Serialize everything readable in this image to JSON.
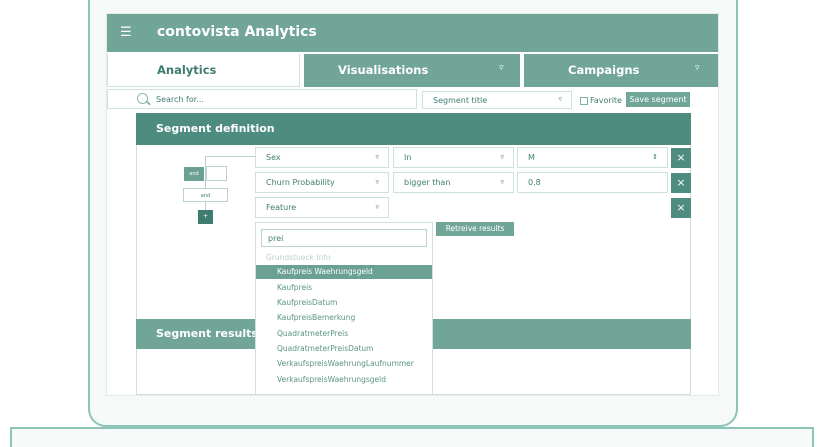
{
  "app": {
    "menu_icon": "hamburger-icon",
    "title": "contovista Analytics"
  },
  "tabs": [
    {
      "label": "Analytics",
      "active": true
    },
    {
      "label": "Visualisations",
      "caret": "▿"
    },
    {
      "label": "Campaigns",
      "caret": "▿"
    }
  ],
  "toolbar": {
    "search_placeholder": "Search for...",
    "segment_title": "Segment title",
    "favorite_label": "Favorite",
    "favorite_checked": false,
    "save_label": "Save segment"
  },
  "segment_definition": {
    "title": "Segment definition",
    "tree": {
      "node1": "and",
      "node2": "and",
      "add": "+"
    },
    "rules": [
      {
        "field": "Sex",
        "operator": "In",
        "value": "M"
      },
      {
        "field": "Churn Probability",
        "operator": "bigger than",
        "value": "0.8"
      },
      {
        "field": "Feature"
      }
    ],
    "remove_icon": "×",
    "carets": {
      "down": "▿",
      "updown": "⇕"
    }
  },
  "dropdown": {
    "search_value": "prei",
    "group": "Grundstueck Info",
    "items": [
      "Kaufpreis Waehrungsgeld",
      "Kaufpreis",
      "KaufpreisDatum",
      "KaufpreisBemerkung",
      "QuadratmeterPreis",
      "QuadratmeterPreisDatum",
      "VerkaufspreisWaehrungLaufnummer",
      "VerkaufspreisWaehrungsgeld"
    ],
    "selected_index": 0,
    "retrieve_label": "Retreive results"
  },
  "segment_results": {
    "title": "Segment results"
  }
}
